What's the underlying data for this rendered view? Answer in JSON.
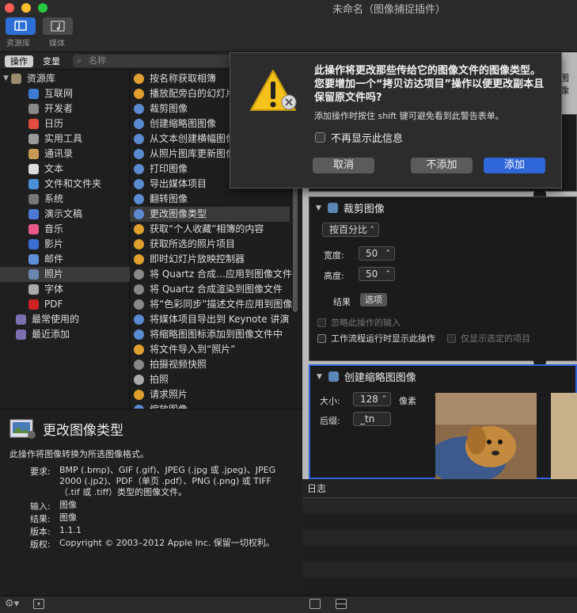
{
  "window": {
    "title": "未命名（图像捕捉插件）"
  },
  "toolbar": {
    "library_label": "资源库",
    "media_label": "媒体"
  },
  "tabs": {
    "actions": "操作",
    "variables": "变量"
  },
  "search": {
    "placeholder": "名称"
  },
  "library": {
    "root": "资源库",
    "items": [
      "互联网",
      "开发者",
      "日历",
      "实用工具",
      "通讯录",
      "文本",
      "文件和文件夹",
      "系统",
      "演示文稿",
      "音乐",
      "影片",
      "邮件",
      "照片",
      "字体",
      "PDF"
    ],
    "selected": "照片",
    "smart": [
      "最常使用的",
      "最近添加"
    ]
  },
  "actions": {
    "items": [
      "按名称获取相簿",
      "播放配旁白的幻灯片",
      "裁剪图像",
      "创建缩略图图像",
      "从文本创建横幅图像",
      "从照片图库更新图像",
      "打印图像",
      "导出媒体项目",
      "翻转图像",
      "更改图像类型",
      "获取“个人收藏”相簿的内容",
      "获取所选的照片项目",
      "即时幻灯片放映控制器",
      "将 Quartz 合成…应用到图像文件",
      "将 Quartz 合成渲染到图像文件",
      "将“色彩同步”描述文件应用到图像",
      "将媒体项目导出到 Keynote 讲演",
      "将缩略图图标添加到图像文件中",
      "将文件导入到“照片”",
      "拍摄视频快照",
      "拍照",
      "请求照片",
      "缩放图像"
    ],
    "selected": "更改图像类型"
  },
  "description": {
    "title": "更改图像类型",
    "summary": "此操作将图像转换为所选图像格式。",
    "rows": [
      {
        "k": "要求:",
        "v": "BMP (.bmp)、GIF (.gif)、JPEG (.jpg 或 .jpeg)、JPEG 2000 (.jp2)、PDF（单页 .pdf）、PNG (.png) 或 TIFF（.tif 或 .tiff）类型的图像文件。"
      },
      {
        "k": "输入:",
        "v": "图像"
      },
      {
        "k": "结果:",
        "v": "图像"
      },
      {
        "k": "版本:",
        "v": "1.1.1"
      },
      {
        "k": "版权:",
        "v": "Copyright © 2003–2012 Apple Inc. 保留一切权利。"
      }
    ]
  },
  "dialog": {
    "message": "此操作将更改那些传给它的图像文件的图像类型。您要增加一个“拷贝访达项目”操作以便更改副本且保留原文件吗?",
    "hint": "添加操作时按住 shift 键可避免看到此警告表单。",
    "checkbox": "不再显示此信息",
    "cancel": "取消",
    "dont_add": "不添加",
    "add": "添加"
  },
  "crop_card": {
    "title": "裁剪图像",
    "mode": "按百分比",
    "width_label": "宽度:",
    "width_value": "50",
    "height_label": "高度:",
    "height_value": "50",
    "result_label": "结果",
    "options_label": "选项",
    "ignore_input": "忽略此操作的输入",
    "show_when_run": "工作流程运行时显示此操作",
    "only_selected": "仅显示选定的项目"
  },
  "thumb_card": {
    "title": "创建缩略图图像",
    "size_label": "大小:",
    "size_value": "128",
    "size_unit": "像素",
    "suffix_label": "后缀:",
    "suffix_value": "_tn"
  },
  "log": {
    "title": "日志"
  },
  "partial_right": "图像"
}
